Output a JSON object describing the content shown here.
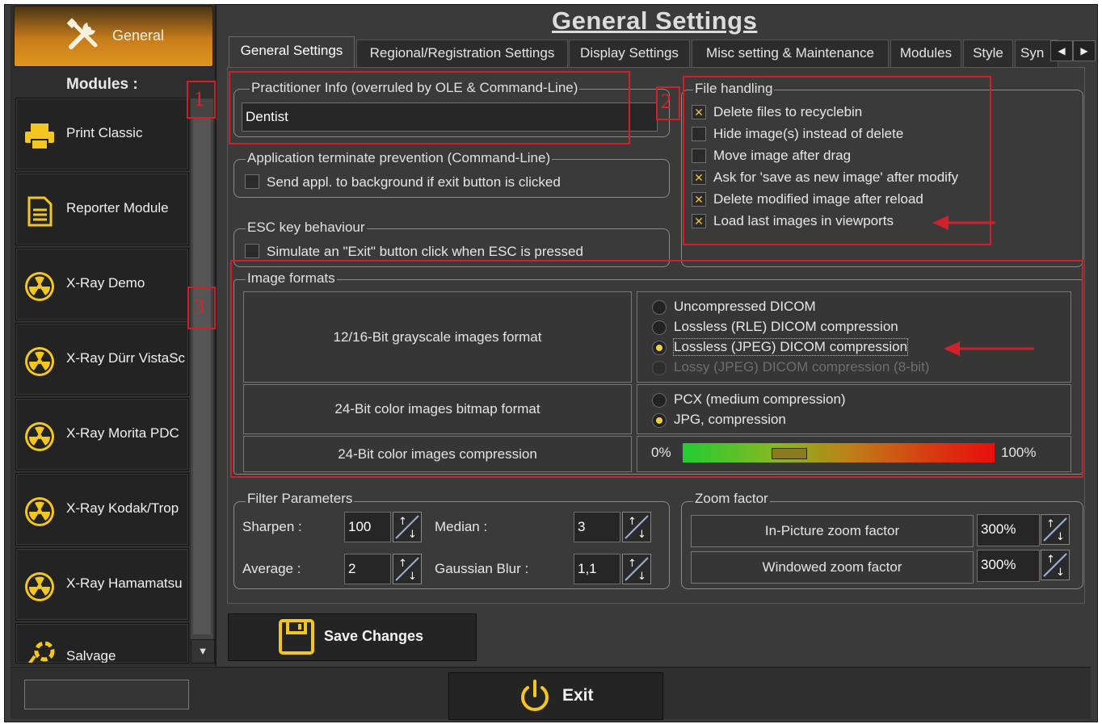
{
  "sidebar": {
    "general_label": "General",
    "modules_title": "Modules :",
    "items": [
      {
        "label": "Print Classic",
        "icon": "printer-icon"
      },
      {
        "label": "Reporter Module",
        "icon": "document-icon"
      },
      {
        "label": "X-Ray Demo",
        "icon": "radiation-icon"
      },
      {
        "label": "X-Ray Dürr VistaSc",
        "icon": "radiation-icon"
      },
      {
        "label": "X-Ray Morita PDC",
        "icon": "radiation-icon"
      },
      {
        "label": "X-Ray Kodak/Trop",
        "icon": "radiation-icon"
      },
      {
        "label": "X-Ray Hamamatsu",
        "icon": "radiation-icon"
      },
      {
        "label": "Salvage",
        "icon": "lifebuoy-icon"
      }
    ]
  },
  "header": {
    "title": "General Settings"
  },
  "tabs": [
    "General Settings",
    "Regional/Registration Settings",
    "Display Settings",
    "Misc setting & Maintenance",
    "Modules",
    "Style",
    "Syn"
  ],
  "practitioner": {
    "group_title": "Practitioner Info (overruled by OLE & Command-Line)",
    "value": "Dentist"
  },
  "terminate": {
    "group_title": "Application terminate prevention (Command-Line)",
    "checkbox_label": "Send appl. to background if exit button is clicked",
    "checked": false
  },
  "esc": {
    "group_title": "ESC key behaviour",
    "checkbox_label": "Simulate an \"Exit\" button click when ESC is pressed",
    "checked": false
  },
  "file_handling": {
    "group_title": "File handling",
    "items": [
      {
        "label": "Delete files to recyclebin",
        "checked": true,
        "mark": "✕"
      },
      {
        "label": "Hide image(s) instead of delete",
        "checked": false,
        "mark": ""
      },
      {
        "label": "Move image after drag",
        "checked": false,
        "mark": ""
      },
      {
        "label": "Ask for 'save as new image' after modify",
        "checked": true,
        "mark": "✕"
      },
      {
        "label": "Delete modified image after reload",
        "checked": true,
        "mark": "✕"
      },
      {
        "label": "Load last images in viewports",
        "checked": true,
        "mark": "✕"
      }
    ]
  },
  "image_formats": {
    "group_title": "Image formats",
    "grayscale_label": "12/16-Bit grayscale images format",
    "grayscale_options": [
      {
        "label": "Uncompressed DICOM",
        "selected": false,
        "disabled": false
      },
      {
        "label": "Lossless (RLE) DICOM compression",
        "selected": false,
        "disabled": false
      },
      {
        "label": "Lossless (JPEG) DICOM compression",
        "selected": true,
        "disabled": false
      },
      {
        "label": "Lossy (JPEG) DICOM compression (8-bit)",
        "selected": false,
        "disabled": true
      }
    ],
    "color_label": "24-Bit color images bitmap format",
    "color_options": [
      {
        "label": "PCX (medium compression)",
        "selected": false
      },
      {
        "label": "JPG, compression",
        "selected": true
      }
    ],
    "compression_label": "24-Bit color images compression",
    "compression_min": "0%",
    "compression_max": "100%",
    "compression_level": 0.29
  },
  "filter": {
    "group_title": "Filter Parameters",
    "sharpen_label": "Sharpen :",
    "sharpen_value": "100",
    "median_label": "Median :",
    "median_value": "3",
    "average_label": "Average :",
    "average_value": "2",
    "gaussian_label": "Gaussian Blur :",
    "gaussian_value": "1,1"
  },
  "zoom": {
    "group_title": "Zoom factor",
    "in_picture_label": "In-Picture zoom factor",
    "in_picture_value": "300%",
    "windowed_label": "Windowed zoom factor",
    "windowed_value": "300%"
  },
  "buttons": {
    "save_label": "Save Changes",
    "exit_label": "Exit"
  },
  "annotations": {
    "n1": "1",
    "n2": "2",
    "n3": "3"
  },
  "colors": {
    "accent_orange": "#e0941e",
    "icon_yellow": "#f3c620",
    "annotation_red": "#d0202a"
  }
}
